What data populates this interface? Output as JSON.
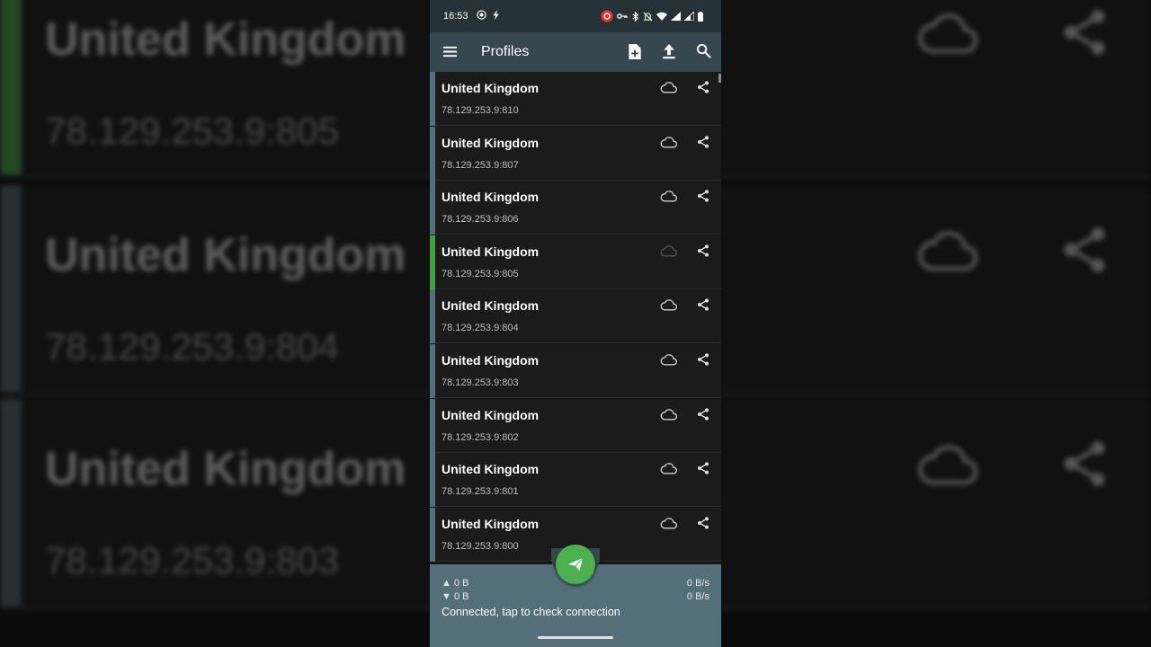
{
  "background": {
    "rows": [
      {
        "name": "United Kingdom",
        "address": "78.129.253.9:805",
        "selected": true
      },
      {
        "name": "United Kingdom",
        "address": "78.129.253.9:804",
        "selected": false
      },
      {
        "name": "United Kingdom",
        "address": "78.129.253.9:803",
        "selected": false
      }
    ]
  },
  "statusbar": {
    "time": "16:53"
  },
  "appbar": {
    "title": "Profiles"
  },
  "profiles": [
    {
      "name": "United Kingdom",
      "address": "78.129.253.9:810",
      "selected": false
    },
    {
      "name": "United Kingdom",
      "address": "78.129.253.9:807",
      "selected": false
    },
    {
      "name": "United Kingdom",
      "address": "78.129.253.9:806",
      "selected": false
    },
    {
      "name": "United Kingdom",
      "address": "78.129.253.9:805",
      "selected": true
    },
    {
      "name": "United Kingdom",
      "address": "78.129.253.9:804",
      "selected": false
    },
    {
      "name": "United Kingdom",
      "address": "78.129.253.9:803",
      "selected": false
    },
    {
      "name": "United Kingdom",
      "address": "78.129.253.9:802",
      "selected": false
    },
    {
      "name": "United Kingdom",
      "address": "78.129.253.9:801",
      "selected": false
    },
    {
      "name": "United Kingdom",
      "address": "78.129.253.9:800",
      "selected": false
    }
  ],
  "traffic": {
    "upload_total": "▲ 0 B",
    "download_total": "▼ 0 B",
    "upload_speed": "0 B/s",
    "download_speed": "0 B/s",
    "status": "Connected, tap to check connection"
  },
  "colors": {
    "appbar": "#37474f",
    "statusbar": "#263238",
    "bottom_panel": "#546e7a",
    "selected_indicator": "#43a047",
    "fab": "#4caf50"
  }
}
